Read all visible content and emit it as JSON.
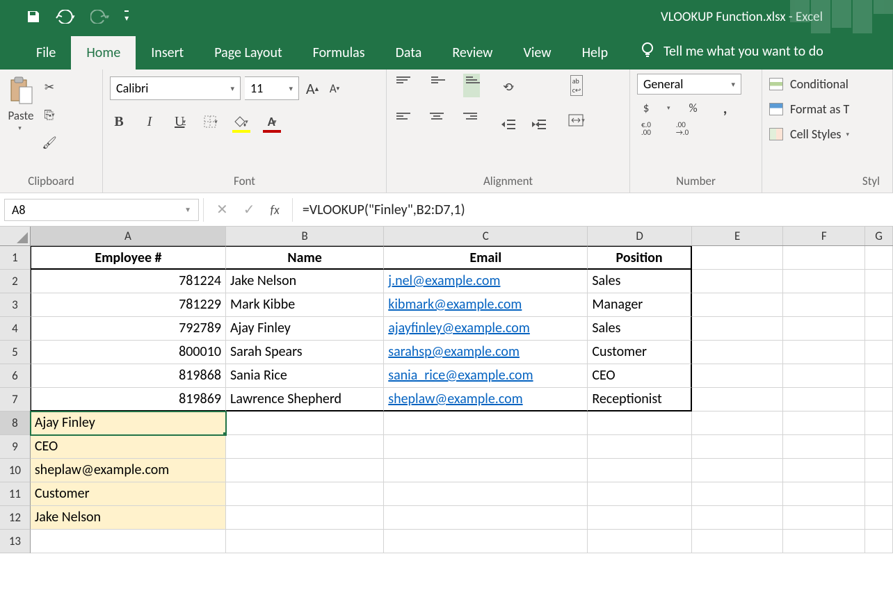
{
  "titlebar": {
    "filename": "VLOOKUP Function.xlsx",
    "appname": "Excel"
  },
  "tabs": {
    "file": "File",
    "home": "Home",
    "insert": "Insert",
    "pagelayout": "Page Layout",
    "formulas": "Formulas",
    "data": "Data",
    "review": "Review",
    "view": "View",
    "help": "Help",
    "tellme": "Tell me what you want to do"
  },
  "ribbon": {
    "clipboard": {
      "label": "Clipboard",
      "paste": "Paste"
    },
    "font": {
      "label": "Font",
      "name": "Calibri",
      "size": "11"
    },
    "alignment": {
      "label": "Alignment"
    },
    "number": {
      "label": "Number",
      "format": "General",
      "currency": "$",
      "percent": "%",
      "comma": ",",
      "inc": ".0",
      "inc2": ".00",
      "dec": ".00",
      "dec2": ".0"
    },
    "styles": {
      "label": "Styl",
      "conditional": "Conditional",
      "formatastable": "Format as T",
      "cellstyles": "Cell Styles"
    }
  },
  "fbar": {
    "nameref": "A8",
    "fx": "fx",
    "formula": "=VLOOKUP(\"Finley\",B2:D7,1)"
  },
  "cols": [
    "A",
    "B",
    "C",
    "D",
    "E",
    "F",
    "G"
  ],
  "rownums": [
    "1",
    "2",
    "3",
    "4",
    "5",
    "6",
    "7",
    "8",
    "9",
    "10",
    "11",
    "12",
    "13"
  ],
  "headers": {
    "A": "Employee #",
    "B": "Name",
    "C": "Email",
    "D": "Position"
  },
  "rows": [
    {
      "A": "781224",
      "B": "Jake Nelson",
      "C": "j.nel@example.com",
      "D": "Sales"
    },
    {
      "A": "781229",
      "B": "Mark Kibbe",
      "C": "kibmark@example.com",
      "D": "Manager"
    },
    {
      "A": "792789",
      "B": "Ajay Finley",
      "C": "ajayfinley@example.com",
      "D": "Sales"
    },
    {
      "A": "800010",
      "B": "Sarah Spears",
      "C": "sarahsp@example.com",
      "D": "Customer"
    },
    {
      "A": "819868",
      "B": "Sania Rice",
      "C": "sania_rice@example.com",
      "D": "CEO"
    },
    {
      "A": "819869",
      "B": "Lawrence Shepherd",
      "C": "sheplaw@example.com",
      "D": "Receptionist"
    }
  ],
  "results": {
    "r8": "Ajay Finley",
    "r9": "CEO",
    "r10": "sheplaw@example.com",
    "r11": "Customer",
    "r12": "Jake Nelson"
  }
}
